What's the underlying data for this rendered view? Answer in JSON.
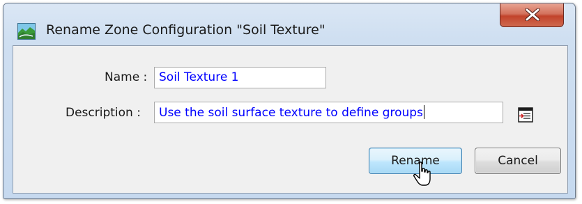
{
  "window": {
    "title": "Rename Zone Configuration \"Soil Texture\"",
    "app_icon": "map-landscape-icon",
    "close_icon": "close-icon"
  },
  "form": {
    "name_label": "Name :",
    "name_value": "Soil Texture 1",
    "description_label": "Description :",
    "description_value": "Use the soil surface texture to define groups",
    "text_editor_icon": "text-editor-icon"
  },
  "buttons": {
    "rename": "Rename",
    "cancel": "Cancel"
  },
  "colors": {
    "field_text": "#0000ff",
    "close_button": "#c2432b",
    "default_button_border": "#3c7fb1"
  }
}
